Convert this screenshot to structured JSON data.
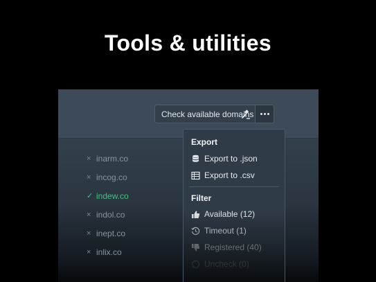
{
  "slide": {
    "title": "Tools & utilities"
  },
  "toolbar": {
    "check_label": "Check available domains",
    "check_icon": "gavel-icon",
    "more_icon": "ellipsis-icon"
  },
  "domains": [
    {
      "name": "inarm.co",
      "status": "unavailable",
      "mark": "×"
    },
    {
      "name": "incog.co",
      "status": "unavailable",
      "mark": "×"
    },
    {
      "name": "indew.co",
      "status": "available",
      "mark": "✓"
    },
    {
      "name": "indol.co",
      "status": "unavailable",
      "mark": "×"
    },
    {
      "name": "inept.co",
      "status": "unavailable",
      "mark": "×"
    },
    {
      "name": "inlix.co",
      "status": "unavailable",
      "mark": "×"
    }
  ],
  "menu": {
    "export_heading": "Export",
    "export_json": "Export to .json",
    "export_csv": "Export to .csv",
    "filter_heading": "Filter",
    "filter_available": "Available (12)",
    "filter_timeout": "Timeout (1)",
    "filter_registered": "Registered (40)",
    "filter_uncheck": "Uncheck (0)"
  },
  "colors": {
    "available": "#3ec47e",
    "unavailable": "#8794a2",
    "panel": "#3a4754",
    "menu": "#2f3b47"
  }
}
